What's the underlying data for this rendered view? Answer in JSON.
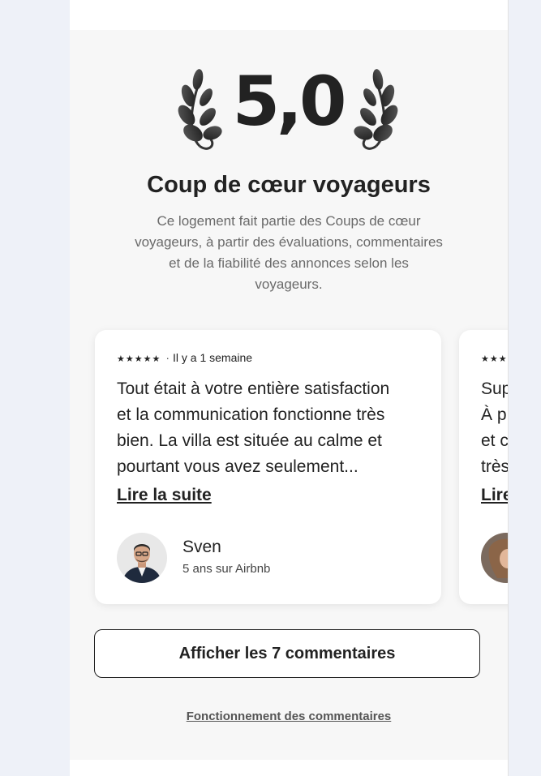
{
  "rating": {
    "value": "5,0"
  },
  "award": {
    "title": "Coup de cœur voyageurs",
    "description": "Ce logement fait partie des Coups de cœur voyageurs, à partir des évaluations, commentaires et de la fiabilité des annonces selon les voyageurs."
  },
  "reviews": [
    {
      "stars": "★★★★★",
      "stars_value": 5,
      "time": "Il y a 1 semaine",
      "lines": [
        "Tout était à votre entière satisfaction",
        "et la communication fonctionne très",
        "bien. La villa est située au calme et",
        "pourtant vous avez seulement..."
      ],
      "read_more": "Lire la suite",
      "name": "Sven",
      "since": "5 ans sur Airbnb"
    },
    {
      "stars": "★★★",
      "lines": [
        "Sup",
        "À p",
        "et c",
        "très"
      ],
      "read_more": "Lire"
    }
  ],
  "buttons": {
    "show_all": "Afficher les 7 commentaires"
  },
  "links": {
    "how_reviews_work": "Fonctionnement des commentaires"
  }
}
